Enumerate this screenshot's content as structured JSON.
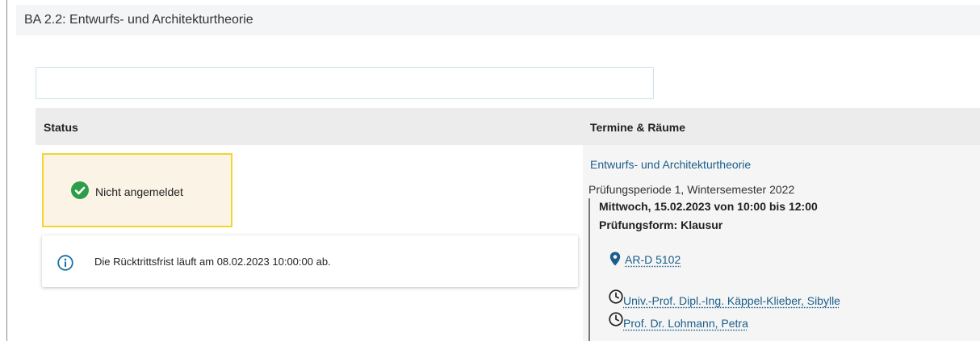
{
  "header": {
    "title": "BA 2.2: Entwurfs- und Architekturtheorie"
  },
  "search": {
    "value": "",
    "placeholder": ""
  },
  "table": {
    "columns": [
      "Status",
      "Termine & Räume"
    ]
  },
  "status": {
    "label": "Nicht angemeldet",
    "icon": "check-circle-icon",
    "color": "#2e9d49"
  },
  "info": {
    "icon": "info-circle-icon",
    "text": "Die Rücktrittsfrist läuft am 08.02.2023 10:00:00 ab."
  },
  "termine": {
    "course": "Entwurfs- und Architekturtheorie",
    "period": "Prüfungsperiode 1, Wintersemester 2022",
    "date": "Mittwoch, 15.02.2023 von 10:00 bis 12:00",
    "form": "Prüfungsform: Klausur",
    "room": "AR-D 5102",
    "examiners": [
      "Univ.-Prof. Dipl.-Ing. Käppel-Klieber, Sibylle",
      "Prof. Dr. Lohmann, Petra"
    ]
  },
  "colors": {
    "link": "#1a5e8a",
    "highlight_border": "#f2d52f",
    "highlight_bg": "#fbf3e6"
  }
}
